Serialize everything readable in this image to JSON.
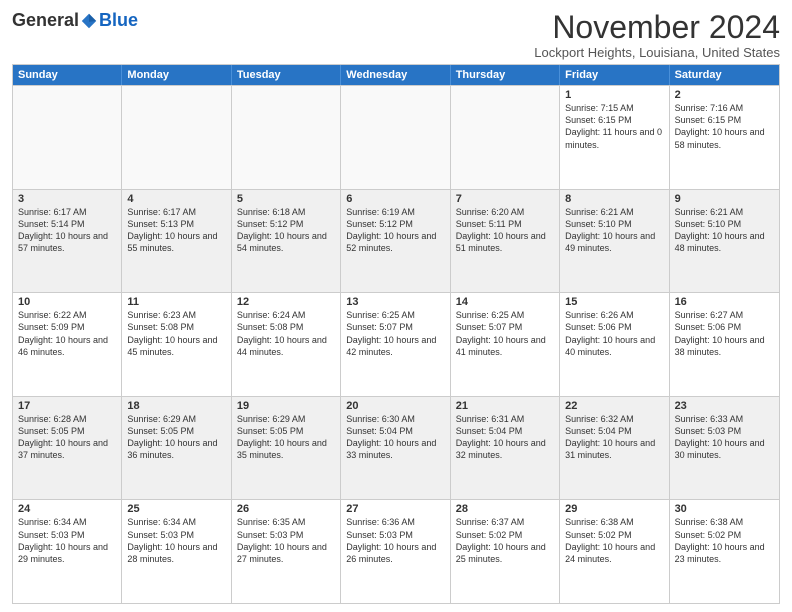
{
  "logo": {
    "general": "General",
    "blue": "Blue"
  },
  "header": {
    "month": "November 2024",
    "location": "Lockport Heights, Louisiana, United States"
  },
  "weekdays": [
    "Sunday",
    "Monday",
    "Tuesday",
    "Wednesday",
    "Thursday",
    "Friday",
    "Saturday"
  ],
  "rows": [
    [
      {
        "day": "",
        "empty": true
      },
      {
        "day": "",
        "empty": true
      },
      {
        "day": "",
        "empty": true
      },
      {
        "day": "",
        "empty": true
      },
      {
        "day": "",
        "empty": true
      },
      {
        "day": "1",
        "sunrise": "Sunrise: 7:15 AM",
        "sunset": "Sunset: 6:15 PM",
        "daylight": "Daylight: 11 hours and 0 minutes."
      },
      {
        "day": "2",
        "sunrise": "Sunrise: 7:16 AM",
        "sunset": "Sunset: 6:15 PM",
        "daylight": "Daylight: 10 hours and 58 minutes."
      }
    ],
    [
      {
        "day": "3",
        "sunrise": "Sunrise: 6:17 AM",
        "sunset": "Sunset: 5:14 PM",
        "daylight": "Daylight: 10 hours and 57 minutes."
      },
      {
        "day": "4",
        "sunrise": "Sunrise: 6:17 AM",
        "sunset": "Sunset: 5:13 PM",
        "daylight": "Daylight: 10 hours and 55 minutes."
      },
      {
        "day": "5",
        "sunrise": "Sunrise: 6:18 AM",
        "sunset": "Sunset: 5:12 PM",
        "daylight": "Daylight: 10 hours and 54 minutes."
      },
      {
        "day": "6",
        "sunrise": "Sunrise: 6:19 AM",
        "sunset": "Sunset: 5:12 PM",
        "daylight": "Daylight: 10 hours and 52 minutes."
      },
      {
        "day": "7",
        "sunrise": "Sunrise: 6:20 AM",
        "sunset": "Sunset: 5:11 PM",
        "daylight": "Daylight: 10 hours and 51 minutes."
      },
      {
        "day": "8",
        "sunrise": "Sunrise: 6:21 AM",
        "sunset": "Sunset: 5:10 PM",
        "daylight": "Daylight: 10 hours and 49 minutes."
      },
      {
        "day": "9",
        "sunrise": "Sunrise: 6:21 AM",
        "sunset": "Sunset: 5:10 PM",
        "daylight": "Daylight: 10 hours and 48 minutes."
      }
    ],
    [
      {
        "day": "10",
        "sunrise": "Sunrise: 6:22 AM",
        "sunset": "Sunset: 5:09 PM",
        "daylight": "Daylight: 10 hours and 46 minutes."
      },
      {
        "day": "11",
        "sunrise": "Sunrise: 6:23 AM",
        "sunset": "Sunset: 5:08 PM",
        "daylight": "Daylight: 10 hours and 45 minutes."
      },
      {
        "day": "12",
        "sunrise": "Sunrise: 6:24 AM",
        "sunset": "Sunset: 5:08 PM",
        "daylight": "Daylight: 10 hours and 44 minutes."
      },
      {
        "day": "13",
        "sunrise": "Sunrise: 6:25 AM",
        "sunset": "Sunset: 5:07 PM",
        "daylight": "Daylight: 10 hours and 42 minutes."
      },
      {
        "day": "14",
        "sunrise": "Sunrise: 6:25 AM",
        "sunset": "Sunset: 5:07 PM",
        "daylight": "Daylight: 10 hours and 41 minutes."
      },
      {
        "day": "15",
        "sunrise": "Sunrise: 6:26 AM",
        "sunset": "Sunset: 5:06 PM",
        "daylight": "Daylight: 10 hours and 40 minutes."
      },
      {
        "day": "16",
        "sunrise": "Sunrise: 6:27 AM",
        "sunset": "Sunset: 5:06 PM",
        "daylight": "Daylight: 10 hours and 38 minutes."
      }
    ],
    [
      {
        "day": "17",
        "sunrise": "Sunrise: 6:28 AM",
        "sunset": "Sunset: 5:05 PM",
        "daylight": "Daylight: 10 hours and 37 minutes."
      },
      {
        "day": "18",
        "sunrise": "Sunrise: 6:29 AM",
        "sunset": "Sunset: 5:05 PM",
        "daylight": "Daylight: 10 hours and 36 minutes."
      },
      {
        "day": "19",
        "sunrise": "Sunrise: 6:29 AM",
        "sunset": "Sunset: 5:05 PM",
        "daylight": "Daylight: 10 hours and 35 minutes."
      },
      {
        "day": "20",
        "sunrise": "Sunrise: 6:30 AM",
        "sunset": "Sunset: 5:04 PM",
        "daylight": "Daylight: 10 hours and 33 minutes."
      },
      {
        "day": "21",
        "sunrise": "Sunrise: 6:31 AM",
        "sunset": "Sunset: 5:04 PM",
        "daylight": "Daylight: 10 hours and 32 minutes."
      },
      {
        "day": "22",
        "sunrise": "Sunrise: 6:32 AM",
        "sunset": "Sunset: 5:04 PM",
        "daylight": "Daylight: 10 hours and 31 minutes."
      },
      {
        "day": "23",
        "sunrise": "Sunrise: 6:33 AM",
        "sunset": "Sunset: 5:03 PM",
        "daylight": "Daylight: 10 hours and 30 minutes."
      }
    ],
    [
      {
        "day": "24",
        "sunrise": "Sunrise: 6:34 AM",
        "sunset": "Sunset: 5:03 PM",
        "daylight": "Daylight: 10 hours and 29 minutes."
      },
      {
        "day": "25",
        "sunrise": "Sunrise: 6:34 AM",
        "sunset": "Sunset: 5:03 PM",
        "daylight": "Daylight: 10 hours and 28 minutes."
      },
      {
        "day": "26",
        "sunrise": "Sunrise: 6:35 AM",
        "sunset": "Sunset: 5:03 PM",
        "daylight": "Daylight: 10 hours and 27 minutes."
      },
      {
        "day": "27",
        "sunrise": "Sunrise: 6:36 AM",
        "sunset": "Sunset: 5:03 PM",
        "daylight": "Daylight: 10 hours and 26 minutes."
      },
      {
        "day": "28",
        "sunrise": "Sunrise: 6:37 AM",
        "sunset": "Sunset: 5:02 PM",
        "daylight": "Daylight: 10 hours and 25 minutes."
      },
      {
        "day": "29",
        "sunrise": "Sunrise: 6:38 AM",
        "sunset": "Sunset: 5:02 PM",
        "daylight": "Daylight: 10 hours and 24 minutes."
      },
      {
        "day": "30",
        "sunrise": "Sunrise: 6:38 AM",
        "sunset": "Sunset: 5:02 PM",
        "daylight": "Daylight: 10 hours and 23 minutes."
      }
    ]
  ]
}
